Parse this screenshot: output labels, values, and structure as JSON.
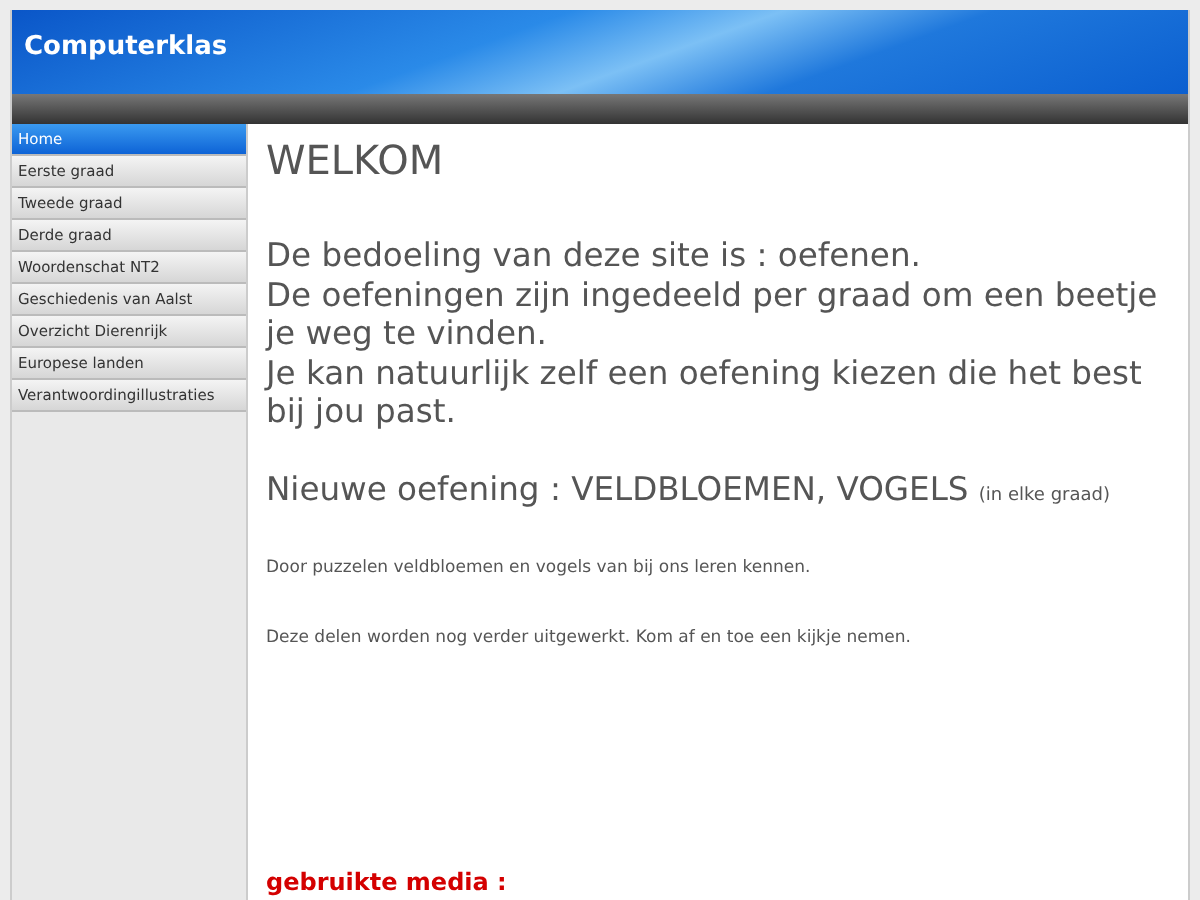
{
  "header": {
    "title": "Computerklas"
  },
  "sidebar": {
    "items": [
      {
        "label": "Home",
        "selected": true
      },
      {
        "label": "Eerste graad",
        "selected": false
      },
      {
        "label": "Tweede graad",
        "selected": false
      },
      {
        "label": "Derde graad",
        "selected": false
      },
      {
        "label": "Woordenschat NT2",
        "selected": false
      },
      {
        "label": "Geschiedenis van Aalst",
        "selected": false
      },
      {
        "label": "Overzicht Dierenrijk",
        "selected": false
      },
      {
        "label": "Europese landen",
        "selected": false
      },
      {
        "label": "Verantwoordingillustraties",
        "selected": false
      }
    ]
  },
  "content": {
    "heading": "WELKOM",
    "intro_lines": [
      "De bedoeling van deze site is : oefenen.",
      "De oefeningen zijn ingedeeld per graad om een beetje je weg te vinden.",
      "Je kan natuurlijk zelf een oefening kiezen die het best bij jou past."
    ],
    "news": {
      "text": "Nieuwe oefening : VELDBLOEMEN, VOGELS",
      "note": "(in elke graad)"
    },
    "paragraphs": [
      "Door puzzelen veldbloemen en vogels van bij ons leren kennen.",
      "Deze delen worden nog verder uitgewerkt. Kom af en toe een kijkje nemen."
    ],
    "media_heading": "gebruikte media :"
  }
}
